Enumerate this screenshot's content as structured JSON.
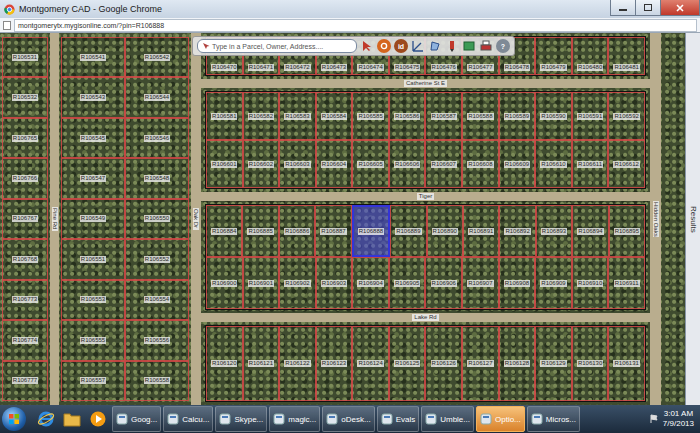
{
  "window": {
    "title": "Montgomery CAD - Google Chrome"
  },
  "address_bar": {
    "url": "montgomerytx.mygisonline.com/?pin=R106888"
  },
  "map_toolbar": {
    "search_placeholder": "Type in a Parcel, Owner, Address....",
    "id_label": "id",
    "help_label": "?"
  },
  "results_tab": {
    "label": "Results"
  },
  "roads": {
    "top": "Catherine St E",
    "middle": "Tiger",
    "bottom": "Lake Rd",
    "west": "Pine Rd",
    "inner": "Oak Dr",
    "east": "Hidden Oaks"
  },
  "blocks": {
    "west": [
      [
        {
          "id": "R106531",
          "selected": false
        }
      ],
      [
        {
          "id": "R106532",
          "selected": false
        }
      ],
      [
        {
          "id": "R106765",
          "selected": false
        }
      ],
      [
        {
          "id": "R106766",
          "selected": false
        }
      ],
      [
        {
          "id": "R106767",
          "selected": false
        }
      ],
      [
        {
          "id": "R106768",
          "selected": false
        }
      ],
      [
        {
          "id": "R106773",
          "selected": false
        }
      ],
      [
        {
          "id": "R106774",
          "selected": false
        }
      ],
      [
        {
          "id": "R106777",
          "selected": false
        }
      ]
    ],
    "inner": [
      [
        {
          "id": "R106541",
          "selected": false
        },
        {
          "id": "R106542",
          "selected": false
        }
      ],
      [
        {
          "id": "R106543",
          "selected": false
        },
        {
          "id": "R106544",
          "selected": false
        }
      ],
      [
        {
          "id": "R106545",
          "selected": false
        },
        {
          "id": "R106546",
          "selected": false
        }
      ],
      [
        {
          "id": "R106547",
          "selected": false
        },
        {
          "id": "R106548",
          "selected": false
        }
      ],
      [
        {
          "id": "R106549",
          "selected": false
        },
        {
          "id": "R106550",
          "selected": false
        }
      ],
      [
        {
          "id": "R106551",
          "selected": false
        },
        {
          "id": "R106552",
          "selected": false
        }
      ],
      [
        {
          "id": "R106553",
          "selected": false
        },
        {
          "id": "R106554",
          "selected": false
        }
      ],
      [
        {
          "id": "R106555",
          "selected": false
        },
        {
          "id": "R106556",
          "selected": false
        }
      ],
      [
        {
          "id": "R106557",
          "selected": false
        },
        {
          "id": "R106558",
          "selected": false
        }
      ]
    ],
    "north": [
      [
        {
          "id": "R106470",
          "selected": false
        },
        {
          "id": "R106471",
          "selected": false
        },
        {
          "id": "R106472",
          "selected": false
        },
        {
          "id": "R106473",
          "selected": false
        },
        {
          "id": "R106474",
          "selected": false
        },
        {
          "id": "R106475",
          "selected": false
        },
        {
          "id": "R106476",
          "selected": false
        },
        {
          "id": "R106477",
          "selected": false
        },
        {
          "id": "R106478",
          "selected": false
        },
        {
          "id": "R106479",
          "selected": false
        },
        {
          "id": "R106480",
          "selected": false
        },
        {
          "id": "R106481",
          "selected": false
        }
      ]
    ],
    "upper": [
      [
        {
          "id": "R106581",
          "selected": false
        },
        {
          "id": "R106582",
          "selected": false
        },
        {
          "id": "R106583",
          "selected": false
        },
        {
          "id": "R106584",
          "selected": false
        },
        {
          "id": "R106585",
          "selected": false
        },
        {
          "id": "R106586",
          "selected": false
        },
        {
          "id": "R106587",
          "selected": false
        },
        {
          "id": "R106588",
          "selected": false
        },
        {
          "id": "R106589",
          "selected": false
        },
        {
          "id": "R106590",
          "selected": false
        },
        {
          "id": "R106591",
          "selected": false
        },
        {
          "id": "R106592",
          "selected": false
        }
      ],
      [
        {
          "id": "R106601",
          "selected": false
        },
        {
          "id": "R106602",
          "selected": false
        },
        {
          "id": "R106603",
          "selected": false
        },
        {
          "id": "R106604",
          "selected": false
        },
        {
          "id": "R106605",
          "selected": false
        },
        {
          "id": "R106606",
          "selected": false
        },
        {
          "id": "R106607",
          "selected": false
        },
        {
          "id": "R106608",
          "selected": false
        },
        {
          "id": "R106609",
          "selected": false
        },
        {
          "id": "R106610",
          "selected": false
        },
        {
          "id": "R106611",
          "selected": false
        },
        {
          "id": "R106612",
          "selected": false
        }
      ]
    ],
    "center": [
      [
        {
          "id": "R106884",
          "selected": false
        },
        {
          "id": "R106885",
          "selected": false
        },
        {
          "id": "R106886",
          "selected": false
        },
        {
          "id": "R106887",
          "selected": false
        },
        {
          "id": "R106888",
          "selected": true
        },
        {
          "id": "R106889",
          "selected": false
        },
        {
          "id": "R106890",
          "selected": false
        },
        {
          "id": "R106891",
          "selected": false
        },
        {
          "id": "R106892",
          "selected": false
        },
        {
          "id": "R106893",
          "selected": false
        },
        {
          "id": "R106894",
          "selected": false
        },
        {
          "id": "R106895",
          "selected": false
        }
      ],
      [
        {
          "id": "R106900",
          "selected": false
        },
        {
          "id": "R106901",
          "selected": false
        },
        {
          "id": "R106902",
          "selected": false
        },
        {
          "id": "R106903",
          "selected": false
        },
        {
          "id": "R106904",
          "selected": false
        },
        {
          "id": "R106905",
          "selected": false
        },
        {
          "id": "R106906",
          "selected": false
        },
        {
          "id": "R106907",
          "selected": false
        },
        {
          "id": "R106908",
          "selected": false
        },
        {
          "id": "R106909",
          "selected": false
        },
        {
          "id": "R106910",
          "selected": false
        },
        {
          "id": "R106911",
          "selected": false
        }
      ]
    ],
    "south": [
      [
        {
          "id": "R106120",
          "selected": false
        },
        {
          "id": "R106121",
          "selected": false
        },
        {
          "id": "R106122",
          "selected": false
        },
        {
          "id": "R106123",
          "selected": false
        },
        {
          "id": "R106124",
          "selected": false
        },
        {
          "id": "R106125",
          "selected": false
        },
        {
          "id": "R106126",
          "selected": false
        },
        {
          "id": "R106127",
          "selected": false
        },
        {
          "id": "R106128",
          "selected": false
        },
        {
          "id": "R106129",
          "selected": false
        },
        {
          "id": "R106130",
          "selected": false
        },
        {
          "id": "R106131",
          "selected": false
        }
      ]
    ]
  },
  "taskbar": {
    "tasks": [
      {
        "label": "Goog...",
        "selected": false
      },
      {
        "label": "Calcu...",
        "selected": false
      },
      {
        "label": "Skype...",
        "selected": false
      },
      {
        "label": "magic...",
        "selected": false
      },
      {
        "label": "oDesk...",
        "selected": false
      },
      {
        "label": "Evals",
        "selected": false
      },
      {
        "label": "Umble...",
        "selected": false
      },
      {
        "label": "Optio...",
        "selected": true
      },
      {
        "label": "Micros...",
        "selected": false
      }
    ],
    "clock": {
      "time": "3:01 AM",
      "date": "7/9/2013"
    }
  }
}
